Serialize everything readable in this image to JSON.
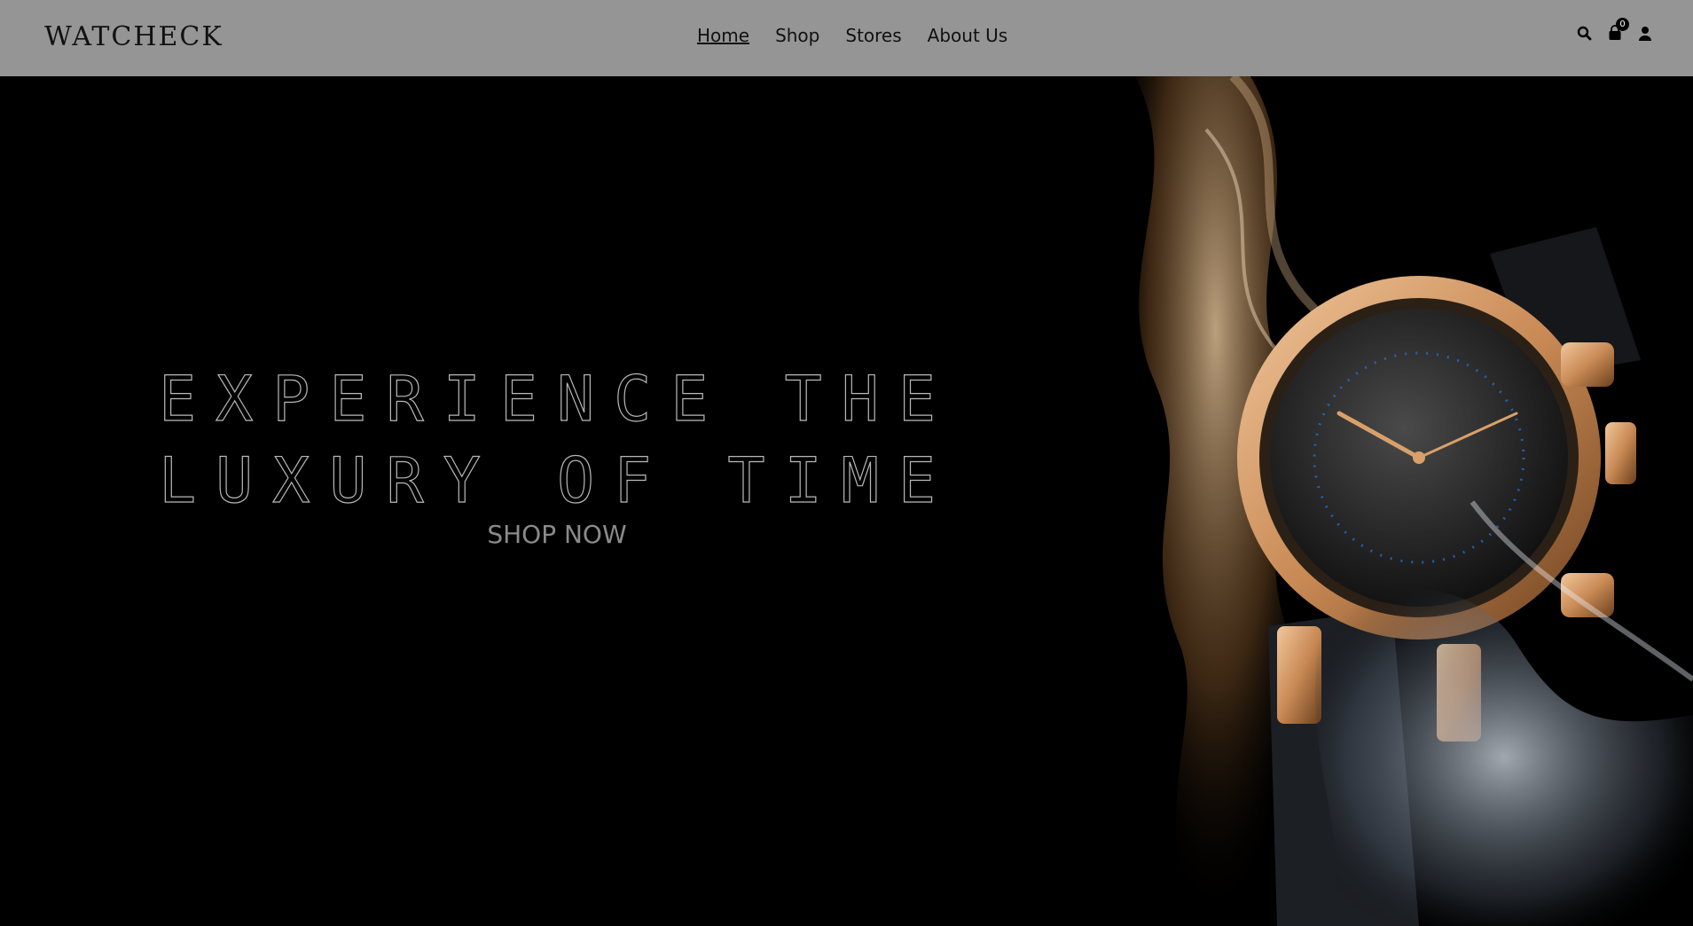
{
  "header": {
    "brand": "WATCHECK",
    "nav": [
      "Home",
      "Shop",
      "Stores",
      "About Us"
    ],
    "active_nav": "Home",
    "icons": [
      "search-icon",
      "shopping-bag-icon",
      "user-icon"
    ],
    "cart_count": "0"
  },
  "hero": {
    "headline_line1": "EXPERIENCE THE",
    "headline_line2": "LUXURY OF TIME",
    "cta_label": "SHOP NOW"
  },
  "colors": {
    "header_bg": "#959595",
    "hero_bg": "#000000",
    "headline_outline": "#b8b8b8",
    "cta_text": "#8a8a8a",
    "watch_gold": "#c98a55"
  }
}
